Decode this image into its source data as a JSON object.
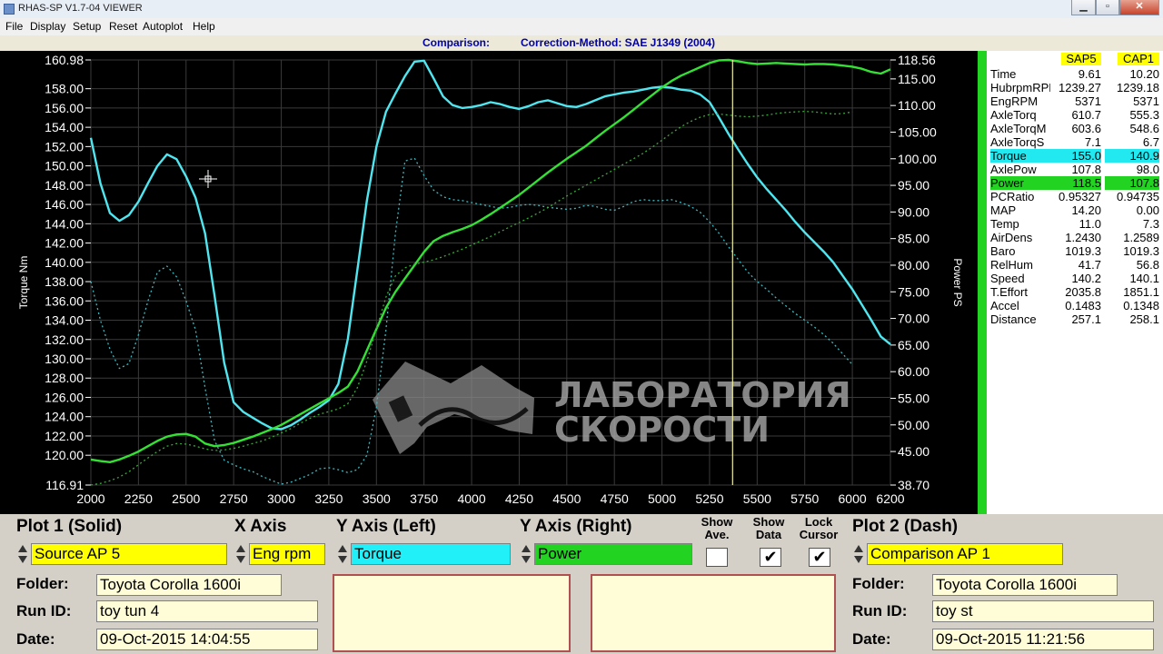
{
  "window": {
    "title": "RHAS-SP V1.7-04  VIEWER",
    "minimize": "▁",
    "restore": "▫",
    "close": "✕"
  },
  "menu": [
    "File",
    "Display",
    "Setup",
    "Reset",
    "Autoplot",
    "Help"
  ],
  "subheader": {
    "label": "Comparison:",
    "method": "Correction-Method: SAE J1349 (2004)"
  },
  "chart_data": {
    "type": "line",
    "title": "",
    "xlabel": "",
    "ylabel": "Torque Nm",
    "y2label": "Power PS",
    "xlim": [
      2000,
      6200
    ],
    "ylim": [
      116.91,
      160.98
    ],
    "y2lim": [
      38.7,
      118.56
    ],
    "x_ticks": [
      2000,
      2250,
      2500,
      2750,
      3000,
      3250,
      3500,
      3750,
      4000,
      4250,
      4500,
      4750,
      5000,
      5250,
      5500,
      5750,
      6000,
      6200
    ],
    "y_ticks": [
      "160.98",
      "158.00",
      "156.00",
      "154.00",
      "152.00",
      "150.00",
      "148.00",
      "146.00",
      "144.00",
      "142.00",
      "140.00",
      "138.00",
      "136.00",
      "134.00",
      "132.00",
      "130.00",
      "128.00",
      "126.00",
      "124.00",
      "122.00",
      "120.00",
      "116.91"
    ],
    "y2_ticks": [
      "118.56",
      "115.00",
      "110.00",
      "105.00",
      "100.00",
      "95.00",
      "90.00",
      "85.00",
      "80.00",
      "75.00",
      "70.00",
      "65.00",
      "60.00",
      "55.00",
      "50.00",
      "45.00",
      "38.70"
    ],
    "cursor_x": 5371,
    "grid": true,
    "series": [
      {
        "name": "Torque",
        "axis": "left",
        "style": "solid",
        "color": "#4fe6f0",
        "x": [
          2000,
          2050,
          2100,
          2150,
          2200,
          2250,
          2300,
          2350,
          2400,
          2450,
          2500,
          2550,
          2600,
          2650,
          2700,
          2750,
          2800,
          2850,
          2900,
          2950,
          3000,
          3050,
          3100,
          3150,
          3200,
          3250,
          3300,
          3350,
          3400,
          3450,
          3500,
          3550,
          3600,
          3650,
          3700,
          3750,
          3800,
          3850,
          3900,
          3950,
          4000,
          4050,
          4100,
          4150,
          4200,
          4250,
          4300,
          4350,
          4400,
          4450,
          4500,
          4550,
          4600,
          4650,
          4700,
          4750,
          4800,
          4850,
          4900,
          4950,
          5000,
          5050,
          5100,
          5150,
          5200,
          5250,
          5300,
          5350,
          5400,
          5450,
          5500,
          5550,
          5600,
          5650,
          5700,
          5750,
          5800,
          5850,
          5900,
          5950,
          6000,
          6050,
          6100,
          6150,
          6200
        ],
        "y": [
          152.9,
          148.2,
          145.1,
          144.3,
          144.9,
          146.3,
          148.2,
          150.0,
          151.2,
          150.7,
          148.9,
          146.7,
          143.0,
          136.5,
          129.6,
          125.5,
          124.5,
          123.9,
          123.3,
          122.8,
          122.7,
          123.1,
          123.7,
          124.4,
          125.0,
          125.7,
          127.4,
          132.1,
          139.2,
          146.4,
          152.0,
          155.6,
          157.5,
          159.3,
          160.8,
          160.9,
          159.1,
          157.2,
          156.3,
          156.0,
          156.1,
          156.3,
          156.6,
          156.4,
          156.1,
          155.9,
          156.2,
          156.6,
          156.8,
          156.5,
          156.2,
          156.1,
          156.4,
          156.8,
          157.2,
          157.4,
          157.6,
          157.7,
          157.9,
          158.1,
          158.2,
          158.1,
          157.9,
          157.8,
          157.4,
          156.6,
          155.0,
          153.3,
          151.7,
          150.2,
          148.8,
          147.6,
          146.5,
          145.4,
          144.2,
          143.1,
          142.1,
          141.1,
          140.0,
          138.6,
          137.2,
          135.6,
          134.0,
          132.3,
          131.5
        ]
      },
      {
        "name": "Power",
        "axis": "right",
        "style": "solid",
        "color": "#35e035",
        "x": [
          2000,
          2050,
          2100,
          2150,
          2200,
          2250,
          2300,
          2350,
          2400,
          2450,
          2500,
          2550,
          2600,
          2650,
          2700,
          2750,
          2800,
          2850,
          2900,
          2950,
          3000,
          3050,
          3100,
          3150,
          3200,
          3250,
          3300,
          3350,
          3400,
          3450,
          3500,
          3550,
          3600,
          3650,
          3700,
          3750,
          3800,
          3850,
          3900,
          3950,
          4000,
          4050,
          4100,
          4150,
          4200,
          4250,
          4300,
          4350,
          4400,
          4450,
          4500,
          4550,
          4600,
          4650,
          4700,
          4750,
          4800,
          4850,
          4900,
          4950,
          5000,
          5050,
          5100,
          5150,
          5200,
          5250,
          5300,
          5350,
          5400,
          5450,
          5500,
          5550,
          5600,
          5650,
          5700,
          5750,
          5800,
          5850,
          5900,
          5950,
          6000,
          6050,
          6100,
          6150,
          6200
        ],
        "y": [
          43.5,
          43.2,
          43.0,
          43.5,
          44.2,
          45.0,
          46.0,
          47.0,
          47.8,
          48.2,
          48.3,
          47.8,
          46.5,
          46.0,
          46.2,
          46.6,
          47.2,
          47.8,
          48.5,
          49.2,
          50.0,
          51.0,
          52.0,
          53.0,
          54.0,
          55.0,
          56.0,
          57.2,
          60.0,
          64.0,
          68.0,
          72.0,
          75.0,
          77.5,
          80.0,
          82.5,
          84.5,
          85.5,
          86.2,
          86.8,
          87.5,
          88.5,
          89.6,
          90.8,
          92.0,
          93.2,
          94.6,
          96.0,
          97.4,
          98.7,
          100.0,
          101.2,
          102.4,
          103.8,
          105.2,
          106.5,
          107.8,
          109.2,
          110.6,
          112.0,
          113.4,
          114.6,
          115.6,
          116.4,
          117.2,
          118.0,
          118.5,
          118.56,
          118.3,
          118.0,
          117.8,
          117.9,
          118.0,
          117.9,
          117.8,
          117.7,
          117.8,
          117.8,
          117.7,
          117.5,
          117.3,
          116.9,
          116.3,
          116.0,
          116.8
        ]
      },
      {
        "name": "Torque (Comparison)",
        "axis": "left",
        "style": "dash",
        "color": "#3fb8bf",
        "x": [
          2000,
          2050,
          2100,
          2150,
          2200,
          2250,
          2300,
          2350,
          2400,
          2450,
          2500,
          2550,
          2600,
          2650,
          2700,
          2750,
          2800,
          2850,
          2900,
          2950,
          3000,
          3050,
          3100,
          3150,
          3200,
          3250,
          3300,
          3350,
          3400,
          3450,
          3500,
          3550,
          3600,
          3650,
          3700,
          3750,
          3800,
          3850,
          3900,
          3950,
          4000,
          4050,
          4100,
          4150,
          4200,
          4250,
          4300,
          4350,
          4400,
          4450,
          4500,
          4550,
          4600,
          4650,
          4700,
          4750,
          4800,
          4850,
          4900,
          4950,
          5000,
          5050,
          5100,
          5150,
          5200,
          5250,
          5300,
          5350,
          5400,
          5450,
          5500,
          5550,
          5600,
          5650,
          5700,
          5750,
          5800,
          5850,
          5900,
          5950,
          6000
        ],
        "y": [
          138.0,
          134.0,
          131.0,
          129.0,
          129.5,
          132.5,
          136.0,
          139.0,
          139.6,
          138.5,
          136.0,
          133.0,
          127.0,
          121.5,
          119.5,
          119.0,
          118.6,
          118.3,
          117.8,
          117.4,
          117.0,
          117.2,
          117.6,
          118.0,
          118.6,
          118.7,
          118.5,
          118.2,
          118.5,
          120.0,
          125.0,
          133.0,
          143.0,
          150.5,
          150.8,
          149.0,
          147.5,
          146.8,
          146.5,
          146.4,
          146.2,
          146.0,
          145.8,
          145.6,
          145.7,
          145.9,
          146.0,
          145.9,
          145.7,
          145.6,
          145.5,
          145.6,
          145.9,
          145.8,
          145.5,
          145.4,
          145.8,
          146.3,
          146.5,
          146.4,
          146.4,
          146.5,
          146.2,
          145.8,
          145.2,
          144.2,
          143.0,
          141.6,
          140.3,
          139.0,
          138.0,
          137.2,
          136.3,
          135.5,
          134.7,
          134.0,
          133.3,
          132.5,
          131.6,
          130.5,
          129.4
        ]
      },
      {
        "name": "Power (Comparison)",
        "axis": "right",
        "style": "dash",
        "color": "#3aa83a",
        "x": [
          2000,
          2050,
          2100,
          2150,
          2200,
          2250,
          2300,
          2350,
          2400,
          2450,
          2500,
          2550,
          2600,
          2650,
          2700,
          2750,
          2800,
          2850,
          2900,
          2950,
          3000,
          3050,
          3100,
          3150,
          3200,
          3250,
          3300,
          3350,
          3400,
          3450,
          3500,
          3550,
          3600,
          3650,
          3700,
          3750,
          3800,
          3850,
          3900,
          3950,
          4000,
          4050,
          4100,
          4150,
          4200,
          4250,
          4300,
          4350,
          4400,
          4450,
          4500,
          4550,
          4600,
          4650,
          4700,
          4750,
          4800,
          4850,
          4900,
          4950,
          5000,
          5050,
          5100,
          5150,
          5200,
          5250,
          5300,
          5350,
          5400,
          5450,
          5500,
          5550,
          5600,
          5650,
          5700,
          5750,
          5800,
          5850,
          5900,
          5950,
          6000
        ],
        "y": [
          38.7,
          39.0,
          39.5,
          40.2,
          41.2,
          42.5,
          43.8,
          45.0,
          46.0,
          46.5,
          46.4,
          46.0,
          45.5,
          45.2,
          45.3,
          45.6,
          46.0,
          46.5,
          47.0,
          47.7,
          48.5,
          49.3,
          50.3,
          51.2,
          52.0,
          52.5,
          53.0,
          54.0,
          57.0,
          62.0,
          68.0,
          74.0,
          78.0,
          79.5,
          80.2,
          80.6,
          81.0,
          81.6,
          82.3,
          83.0,
          83.8,
          84.6,
          85.4,
          86.3,
          87.2,
          88.0,
          88.9,
          89.8,
          90.8,
          91.9,
          93.0,
          94.0,
          95.0,
          96.0,
          97.0,
          98.0,
          99.0,
          100.0,
          101.0,
          102.2,
          103.5,
          104.8,
          106.0,
          107.0,
          107.8,
          108.3,
          108.4,
          108.2,
          108.0,
          107.9,
          108.0,
          108.2,
          108.5,
          108.7,
          108.8,
          108.9,
          108.8,
          108.6,
          108.4,
          108.5,
          108.8
        ]
      }
    ]
  },
  "watermark": {
    "line1": "ЛАБОРАТОРИЯ",
    "line2": "СКОРОСТИ"
  },
  "datapanel": {
    "headers": [
      "SAP5",
      "CAP1"
    ],
    "rows": [
      {
        "name": "Time",
        "v1": "9.61",
        "v2": "10.20"
      },
      {
        "name": "HubrpmRPM",
        "v1": "1239.27",
        "v2": "1239.18"
      },
      {
        "name": "EngRPM",
        "v1": "5371",
        "v2": "5371"
      },
      {
        "name": "AxleTorq",
        "v1": "610.7",
        "v2": "555.3"
      },
      {
        "name": "AxleTorqM",
        "v1": "603.6",
        "v2": "548.6"
      },
      {
        "name": "AxleTorqS",
        "v1": "7.1",
        "v2": "6.7"
      },
      {
        "name": "Torque",
        "v1": "155.0",
        "v2": "140.9",
        "hl": "cyan"
      },
      {
        "name": "AxlePow",
        "v1": "107.8",
        "v2": "98.0"
      },
      {
        "name": "Power",
        "v1": "118.5",
        "v2": "107.8",
        "hl": "green"
      },
      {
        "name": "PCRatio",
        "v1": "0.95327",
        "v2": "0.94735"
      },
      {
        "name": "MAP",
        "v1": "14.20",
        "v2": "0.00"
      },
      {
        "name": "Temp",
        "v1": "11.0",
        "v2": "7.3"
      },
      {
        "name": "AirDens",
        "v1": "1.2430",
        "v2": "1.2589"
      },
      {
        "name": "Baro",
        "v1": "1019.3",
        "v2": "1019.3"
      },
      {
        "name": "RelHum",
        "v1": "41.7",
        "v2": "56.8"
      },
      {
        "name": "Speed",
        "v1": "140.2",
        "v2": "140.1"
      },
      {
        "name": "T.Effort",
        "v1": "2035.8",
        "v2": "1851.1"
      },
      {
        "name": "Accel",
        "v1": "0.1483",
        "v2": "0.1348"
      },
      {
        "name": "Distance",
        "v1": "257.1",
        "v2": "258.1"
      }
    ]
  },
  "bottom": {
    "plot1": {
      "label": "Plot 1 (Solid)",
      "value": "Source AP 5"
    },
    "xaxis": {
      "label": "X Axis",
      "value": "Eng rpm"
    },
    "yleft": {
      "label": "Y Axis (Left)",
      "value": "Torque"
    },
    "yright": {
      "label": "Y Axis (Right)",
      "value": "Power"
    },
    "show_ave": {
      "label1": "Show",
      "label2": "Ave.",
      "checked": false
    },
    "show_data": {
      "label1": "Show",
      "label2": "Data",
      "checked": true
    },
    "lock_cursor": {
      "label1": "Lock",
      "label2": "Cursor",
      "checked": true
    },
    "check_mark": "✔",
    "plot2": {
      "label": "Plot 2 (Dash)",
      "value": "Comparison AP 1"
    },
    "left_info": {
      "folder_label": "Folder:",
      "folder": "Toyota Corolla 1600i",
      "run_label": "Run ID:",
      "run": "toy tun 4",
      "date_label": "Date:",
      "date": "09-Oct-2015  14:04:55"
    },
    "right_info": {
      "folder_label": "Folder:",
      "folder": "Toyota Corolla 1600i",
      "run_label": "Run ID:",
      "run": "toy st",
      "date_label": "Date:",
      "date": "09-Oct-2015  11:21:56"
    }
  }
}
